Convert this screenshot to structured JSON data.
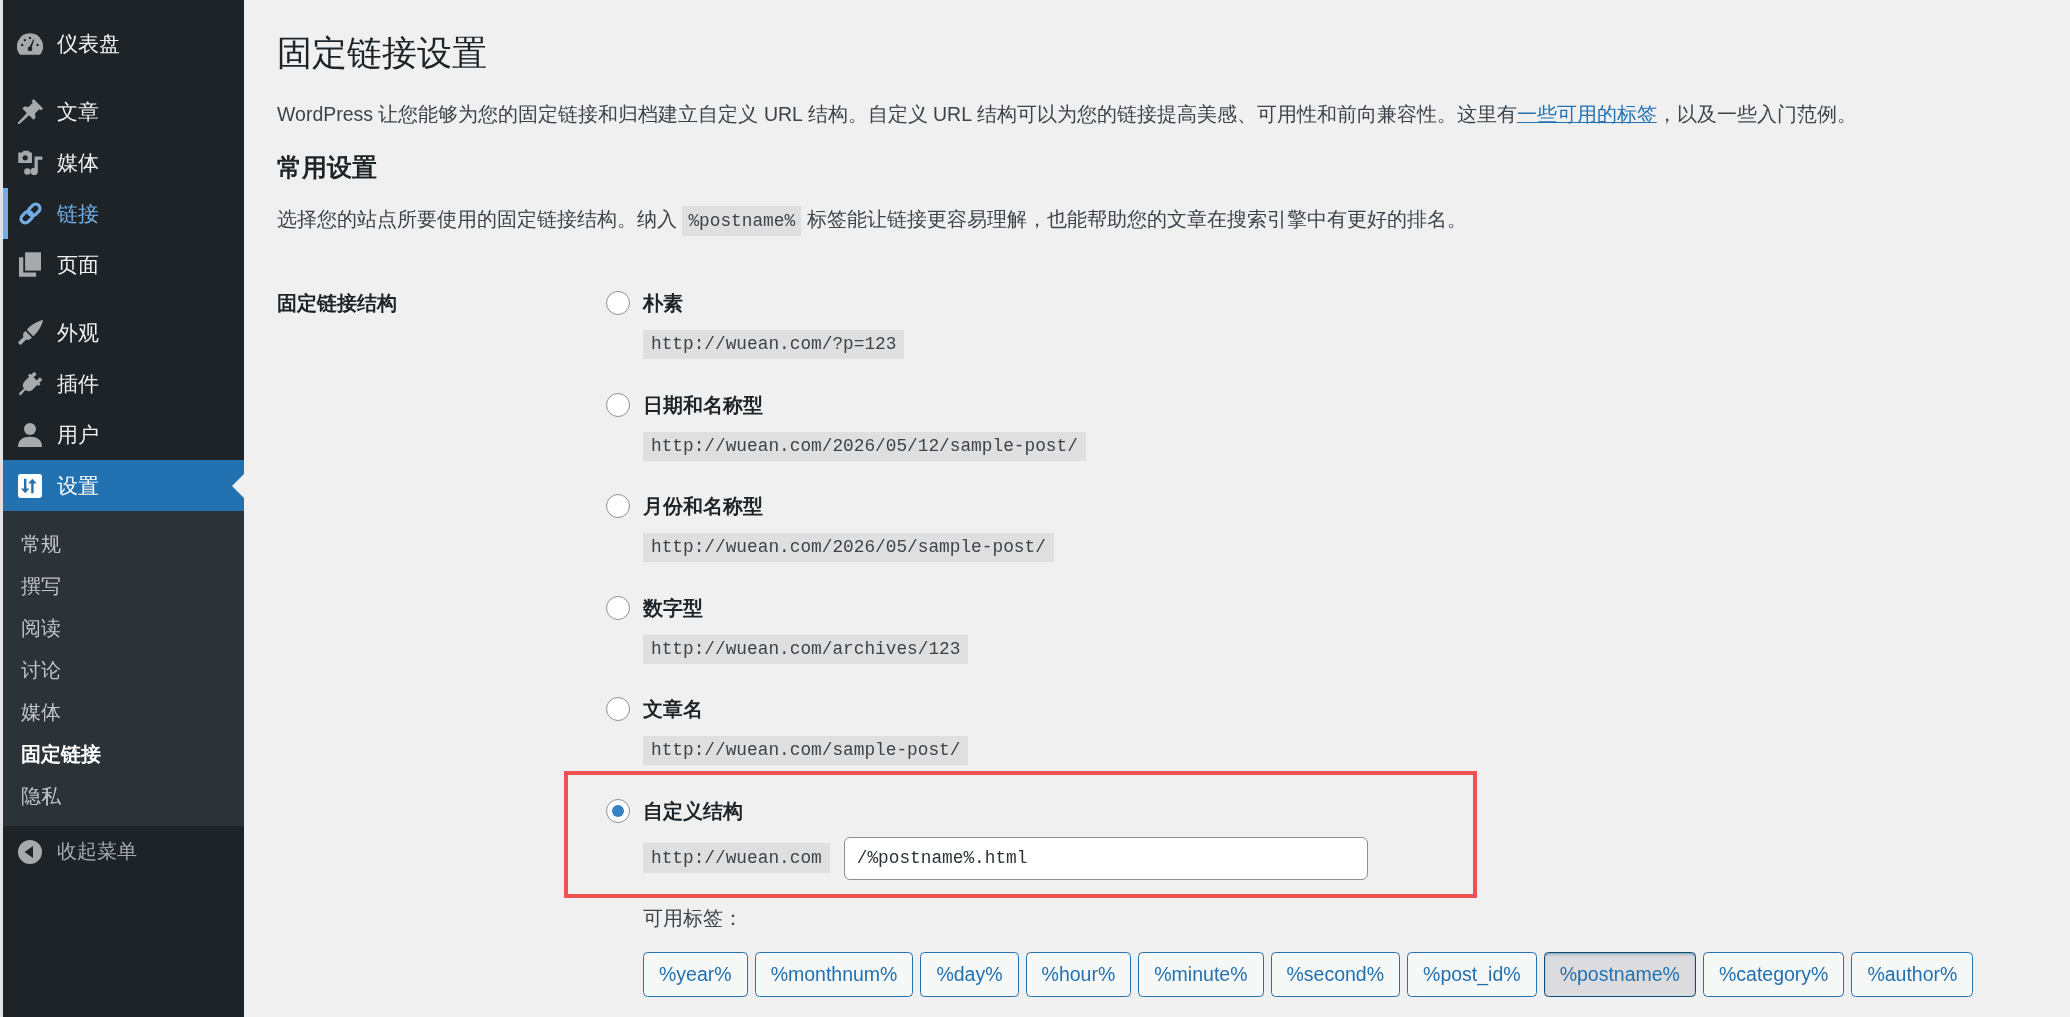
{
  "sidebar": {
    "groups": [
      {
        "items": [
          {
            "label": "仪表盘",
            "kind": "dashboard",
            "selected": false,
            "hover": false
          }
        ]
      },
      {
        "items": [
          {
            "label": "文章",
            "kind": "posts",
            "selected": false,
            "hover": false
          },
          {
            "label": "媒体",
            "kind": "media",
            "selected": false,
            "hover": false
          },
          {
            "label": "链接",
            "kind": "links",
            "selected": false,
            "hover": true
          },
          {
            "label": "页面",
            "kind": "pages",
            "selected": false,
            "hover": false
          }
        ]
      },
      {
        "items": [
          {
            "label": "外观",
            "kind": "appearance",
            "selected": false,
            "hover": false
          },
          {
            "label": "插件",
            "kind": "plugins",
            "selected": false,
            "hover": false
          },
          {
            "label": "用户",
            "kind": "users",
            "selected": false,
            "hover": false
          },
          {
            "label": "设置",
            "kind": "settings",
            "selected": true,
            "hover": false,
            "submenu": [
              {
                "label": "常规",
                "selected": false
              },
              {
                "label": "撰写",
                "selected": false
              },
              {
                "label": "阅读",
                "selected": false
              },
              {
                "label": "讨论",
                "selected": false
              },
              {
                "label": "媒体",
                "selected": false
              },
              {
                "label": "固定链接",
                "selected": true
              },
              {
                "label": "隐私",
                "selected": false
              }
            ]
          }
        ]
      }
    ],
    "collapse": {
      "label": "收起菜单"
    }
  },
  "page": {
    "title": "固定链接设置",
    "intro": {
      "text": "WordPress 让您能够为您的固定链接和归档建立自定义 URL 结构。自定义 URL 结构可以为您的链接提高美感、可用性和前向兼容性。这里有",
      "link": "一些可用的标签",
      "after": "，以及一些入门范例。"
    },
    "section_title": "常用设置",
    "description": {
      "before": "选择您的站点所要使用的固定链接结构。纳入",
      "code": "%postname%",
      "after": "标签能让链接更容易理解，也能帮助您的文章在搜索引擎中有更好的排名。"
    }
  },
  "permalink_structure": {
    "label": "固定链接结构",
    "options": [
      {
        "kind": "preset",
        "label": "朴素",
        "example": "http://wuean.com/?p=123",
        "selected": false,
        "highlighted": false
      },
      {
        "kind": "preset",
        "label": "日期和名称型",
        "example": "http://wuean.com/2026/05/12/sample-post/",
        "selected": false,
        "highlighted": false
      },
      {
        "kind": "preset",
        "label": "月份和名称型",
        "example": "http://wuean.com/2026/05/sample-post/",
        "selected": false,
        "highlighted": false
      },
      {
        "kind": "preset",
        "label": "数字型",
        "example": "http://wuean.com/archives/123",
        "selected": false,
        "highlighted": false
      },
      {
        "kind": "preset",
        "label": "文章名",
        "example": "http://wuean.com/sample-post/",
        "selected": false,
        "highlighted": false
      },
      {
        "kind": "custom",
        "label": "自定义结构",
        "prefix": "http://wuean.com",
        "value": "/%postname%.html",
        "selected": true,
        "highlighted": true
      }
    ],
    "tags_label": "可用标签：",
    "tags": [
      {
        "label": "%year%",
        "pressed": false
      },
      {
        "label": "%monthnum%",
        "pressed": false
      },
      {
        "label": "%day%",
        "pressed": false
      },
      {
        "label": "%hour%",
        "pressed": false
      },
      {
        "label": "%minute%",
        "pressed": false
      },
      {
        "label": "%second%",
        "pressed": false
      },
      {
        "label": "%post_id%",
        "pressed": false
      },
      {
        "label": "%postname%",
        "pressed": true
      },
      {
        "label": "%category%",
        "pressed": false
      },
      {
        "label": "%author%",
        "pressed": false
      }
    ]
  }
}
